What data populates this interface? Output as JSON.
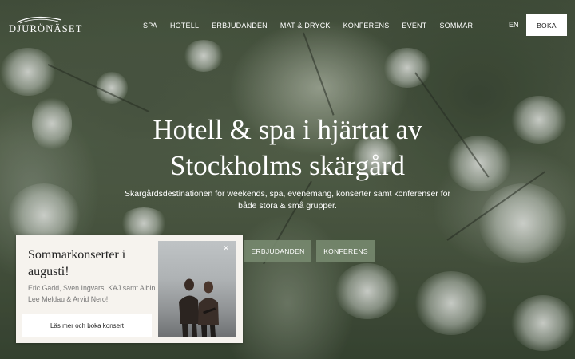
{
  "brand": {
    "logo_text": "DJURÖNÄSET"
  },
  "nav": {
    "items": [
      {
        "label": "SPA"
      },
      {
        "label": "HOTELL"
      },
      {
        "label": "ERBJUDANDEN"
      },
      {
        "label": "MAT & DRYCK"
      },
      {
        "label": "KONFERENS"
      },
      {
        "label": "EVENT"
      },
      {
        "label": "SOMMAR"
      }
    ],
    "language": "EN",
    "book_label": "BOKA"
  },
  "hero": {
    "title_line1": "Hotell & spa i hjärtat av",
    "title_line2": "Stockholms skärgård",
    "subtitle_line1": "Skärgårdsdestinationen för weekends, spa, evenemang, konserter samt konferenser för",
    "subtitle_line2": "både stora & små grupper.",
    "cta_offers": "ERBJUDANDEN",
    "cta_conference": "KONFERENS"
  },
  "popup": {
    "title_line1": "Sommarkonserter i",
    "title_line2": "augusti!",
    "text_line1": "Eric Gadd, Sven Ingvars, KAJ samt Albin",
    "text_line2": "Lee Meldau & Arvid Nero!",
    "button_label": "Läs mer och boka konsert",
    "close_symbol": "×",
    "photo_icon": "musicians-photo"
  },
  "colors": {
    "accent_button": "#7a8c70",
    "popup_background": "#f6f3ee",
    "book_button": "#ffffff"
  }
}
